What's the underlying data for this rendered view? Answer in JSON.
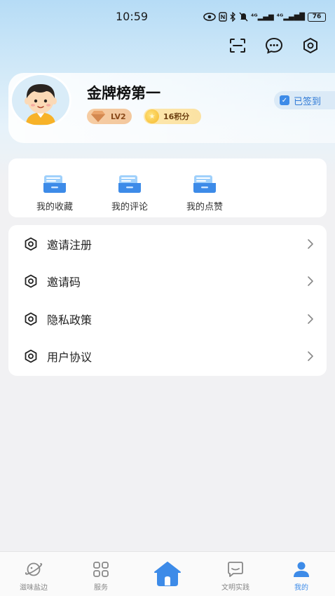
{
  "status_bar": {
    "time": "10:59",
    "signal_1": "⁴ᴳ",
    "signal_2": "⁴ᴳ",
    "battery": "76"
  },
  "top_actions": {
    "scan_icon": "scan-icon",
    "message_icon": "message-icon",
    "settings_icon": "settings-hexagon-icon"
  },
  "profile": {
    "username": "金牌榜第一",
    "level": "LV2",
    "points": "16积分",
    "sign_status": "已签到"
  },
  "quick_links": [
    {
      "label": "我的收藏",
      "icon": "folder-icon"
    },
    {
      "label": "我的评论",
      "icon": "folder-icon"
    },
    {
      "label": "我的点赞",
      "icon": "folder-icon"
    }
  ],
  "menu": [
    {
      "label": "邀请注册",
      "icon": "hexagon-icon"
    },
    {
      "label": "邀请码",
      "icon": "hexagon-icon"
    },
    {
      "label": "隐私政策",
      "icon": "hexagon-icon"
    },
    {
      "label": "用户协议",
      "icon": "hexagon-icon"
    }
  ],
  "tab_bar": [
    {
      "label": "滋味盐边",
      "icon": "planet-icon",
      "active": false
    },
    {
      "label": "服务",
      "icon": "grid-icon",
      "active": false
    },
    {
      "label": "",
      "icon": "home-icon",
      "active": false
    },
    {
      "label": "文明实践",
      "icon": "chat-box-icon",
      "active": false
    },
    {
      "label": "我的",
      "icon": "user-icon",
      "active": true
    }
  ],
  "colors": {
    "accent": "#3d8be8",
    "background": "#f1f1f3"
  }
}
